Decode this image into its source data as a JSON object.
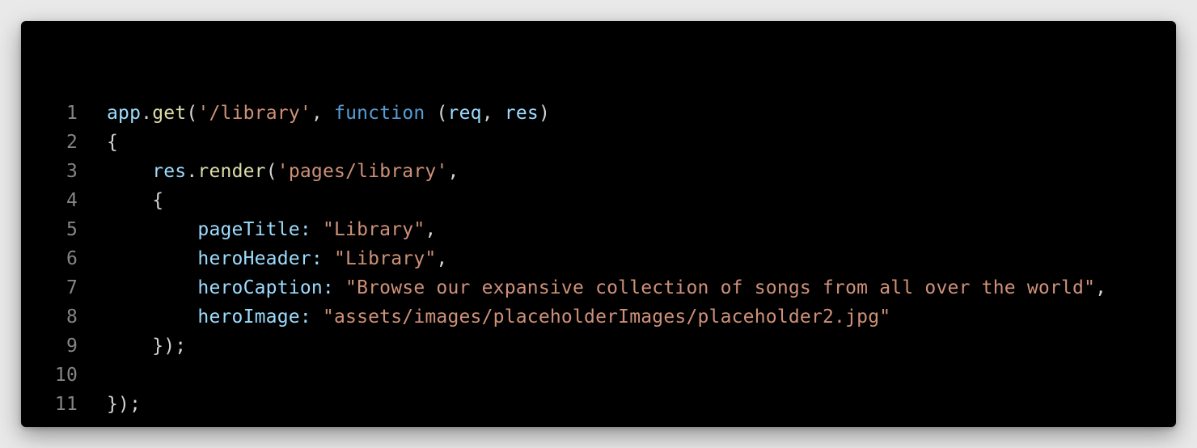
{
  "colors": {
    "background": "#000000",
    "line_number": "#858585",
    "plain": "#d4d4d4",
    "identifier": "#9cdcfe",
    "function": "#dcdcaa",
    "string": "#ce9178",
    "keyword": "#569cd6"
  },
  "code": {
    "lines": [
      {
        "number": "1",
        "tokens": [
          {
            "text": "app",
            "kind": "ident"
          },
          {
            "text": ".",
            "kind": "plain"
          },
          {
            "text": "get",
            "kind": "func"
          },
          {
            "text": "(",
            "kind": "plain"
          },
          {
            "text": "'/library'",
            "kind": "str"
          },
          {
            "text": ", ",
            "kind": "plain"
          },
          {
            "text": "function",
            "kind": "kw"
          },
          {
            "text": " (",
            "kind": "plain"
          },
          {
            "text": "req",
            "kind": "ident"
          },
          {
            "text": ", ",
            "kind": "plain"
          },
          {
            "text": "res",
            "kind": "ident"
          },
          {
            "text": ")",
            "kind": "plain"
          }
        ]
      },
      {
        "number": "2",
        "tokens": [
          {
            "text": "{",
            "kind": "plain"
          }
        ]
      },
      {
        "number": "3",
        "tokens": [
          {
            "text": "    ",
            "kind": "plain"
          },
          {
            "text": "res",
            "kind": "ident"
          },
          {
            "text": ".",
            "kind": "plain"
          },
          {
            "text": "render",
            "kind": "func"
          },
          {
            "text": "(",
            "kind": "plain"
          },
          {
            "text": "'pages/library'",
            "kind": "str"
          },
          {
            "text": ",",
            "kind": "plain"
          }
        ]
      },
      {
        "number": "4",
        "tokens": [
          {
            "text": "    {",
            "kind": "plain"
          }
        ]
      },
      {
        "number": "5",
        "tokens": [
          {
            "text": "        ",
            "kind": "plain"
          },
          {
            "text": "pageTitle",
            "kind": "ident"
          },
          {
            "text": ": ",
            "kind": "ident"
          },
          {
            "text": "\"Library\"",
            "kind": "str"
          },
          {
            "text": ",",
            "kind": "plain"
          }
        ]
      },
      {
        "number": "6",
        "tokens": [
          {
            "text": "        ",
            "kind": "plain"
          },
          {
            "text": "heroHeader",
            "kind": "ident"
          },
          {
            "text": ": ",
            "kind": "ident"
          },
          {
            "text": "\"Library\"",
            "kind": "str"
          },
          {
            "text": ",",
            "kind": "plain"
          }
        ]
      },
      {
        "number": "7",
        "tokens": [
          {
            "text": "        ",
            "kind": "plain"
          },
          {
            "text": "heroCaption",
            "kind": "ident"
          },
          {
            "text": ": ",
            "kind": "ident"
          },
          {
            "text": "\"Browse our expansive collection of songs from all over the world\"",
            "kind": "str"
          },
          {
            "text": ",",
            "kind": "plain"
          }
        ]
      },
      {
        "number": "8",
        "tokens": [
          {
            "text": "        ",
            "kind": "plain"
          },
          {
            "text": "heroImage",
            "kind": "ident"
          },
          {
            "text": ": ",
            "kind": "ident"
          },
          {
            "text": "\"assets/images/placeholderImages/placeholder2.jpg\"",
            "kind": "str"
          }
        ]
      },
      {
        "number": "9",
        "tokens": [
          {
            "text": "    });",
            "kind": "plain"
          }
        ]
      },
      {
        "number": "10",
        "tokens": []
      },
      {
        "number": "11",
        "tokens": [
          {
            "text": "});",
            "kind": "plain"
          }
        ]
      }
    ]
  }
}
